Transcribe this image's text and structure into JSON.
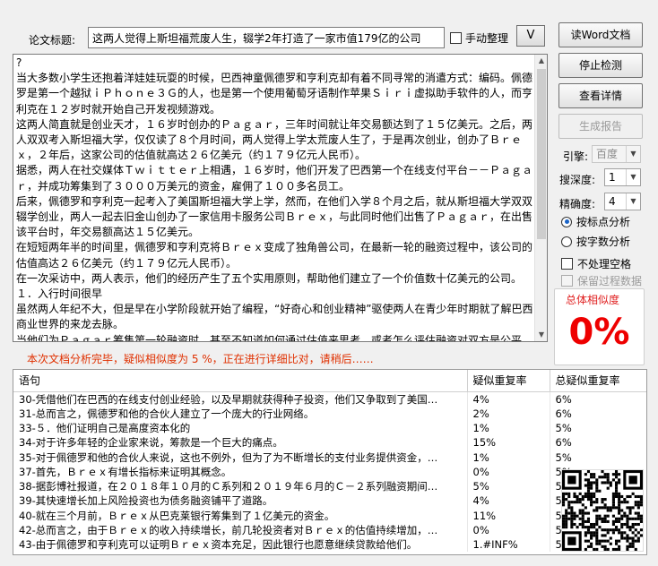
{
  "title_field": {
    "label": "论文标题:",
    "value": "这两人觉得上斯坦福荒废人生，辍学2年打造了一家市值179亿的公司"
  },
  "manual_check": {
    "label": "手动整理",
    "checked": false
  },
  "v_button": {
    "label": "V"
  },
  "document_text": "?\n当大多数小学生还抱着洋娃娃玩耍的时候，巴西神童佩德罗和亨利克却有着不同寻常的消遣方式：编码。佩德罗是第一个越狱ｉＰｈｏｎｅ３Ｇ的人，也是第一个使用葡萄牙语制作苹果Ｓｉｒｉ虚拟助手软件的人，而亨利克在１２岁时就开始自己开发视频游戏。\n这两人简直就是创业天才，１６岁时创办的Ｐａｇａｒ，三年时间就让年交易额达到了１５亿美元。之后，两人双双考入斯坦福大学，仅仅读了８个月时间，两人觉得上学太荒废人生了，于是再次创业，创办了Ｂｒｅｘ，２年后，这家公司的估值就高达２６亿美元（约１７９亿元人民币）。\n据悉，两人在社交媒体Ｔｗｉｔｔｅｒ上相遇，１６岁时，他们开发了巴西第一个在线支付平台－－Ｐａｇａｒ，并成功筹集到了３０００万美元的资金，雇佣了１００多名员工。\n后来，佩德罗和亨利克一起考入了美国斯坦福大学上学，然而，在他们入学８个月之后，就从斯坦福大学双双辍学创业，两人一起去旧金山创办了一家信用卡服务公司Ｂｒｅｘ，与此同时他们出售了Ｐａｇａｒ，在出售该平台时，年交易额高达１５亿美元。\n在短短两年半的时间里，佩德罗和亨利克将Ｂｒｅｘ变成了独角兽公司，在最新一轮的融资过程中，该公司的估值高达２６亿美元（约１７９亿元人民币）。\n在一次采访中，两人表示，他们的经历产生了五个实用原则，帮助他们建立了一个价值数十亿美元的公司。\n１．入行时间很早\n虽然两人年纪不大，但是早在小学阶段就开始了编程，“好奇心和创业精神”驱使两人在青少年时期就了解巴西商业世界的来龙去脉。\n当他们为Ｐａｇａｒ筹集第一轮融资时，甚至不知道如何通过估值来思考，或者怎么评估融资对双方是公平的，但那没关系，这种经历为他们的下一次创业积累了经验。",
  "status_message": "本次文档分析完毕，疑似相似度为 5 %，正在进行详细比对，请稍后……",
  "table": {
    "headers": [
      "语句",
      "疑似重复率",
      "总疑似重复率"
    ],
    "rows": [
      [
        "30-凭借他们在巴西的在线支付创业经验，以及早期就获得种子投资，他们又争取到了美国…",
        "4%",
        "6%"
      ],
      [
        "31-总而言之，佩德罗和他的合伙人建立了一个庞大的行业网络。",
        "2%",
        "6%"
      ],
      [
        "33-５．他们证明自己是高度资本化的",
        "1%",
        "5%"
      ],
      [
        "34-对于许多年轻的企业家来说，筹款是一个巨大的痛点。",
        "15%",
        "6%"
      ],
      [
        "35-对于佩德罗和他的合伙人来说，这也不例外，但为了为不断增长的支付业务提供资金，…",
        "1%",
        "5%"
      ],
      [
        "37-首先，Ｂｒｅｘ有增长指标来证明其概念。",
        "0%",
        "5%"
      ],
      [
        "38-据彭博社报道，在２０１８年１０月的Ｃ系列和２０１９年６月的Ｃ－２系列融资期间…",
        "5%",
        "5%"
      ],
      [
        "39-其快速增长加上风险投资也为债务融资铺平了道路。",
        "4%",
        "5%"
      ],
      [
        "40-就在三个月前，Ｂｒｅｘ从巴克莱银行筹集到了１亿美元的资金。",
        "11%",
        "5%"
      ],
      [
        "42-总而言之，由于Ｂｒｅｘ的收入持续增长，前几轮投资者对Ｂｒｅｘ的估值持续增加，…",
        "0%",
        "5%"
      ],
      [
        "43-由于佩德罗和亨利克可以证明Ｂｒｅｘ资本充足，因此银行也愿意继续贷款给他们。",
        "1.#INF%",
        "5%"
      ]
    ]
  },
  "buttons": {
    "read_word": "读Word文档",
    "stop_detect": "停止检测",
    "view_details": "查看详情",
    "gen_report": "生成报告"
  },
  "engine": {
    "label": "引擎:",
    "value": "百度"
  },
  "search_depth": {
    "label": "搜深度:",
    "value": "1"
  },
  "precision": {
    "label": "精确度:",
    "value": "4"
  },
  "analysis_mode": {
    "by_punct": "按标点分析",
    "by_chars": "按字数分析",
    "selected": "by_punct"
  },
  "options": {
    "no_space": "不处理空格",
    "keep_data": "保留过程数据"
  },
  "similarity": {
    "title": "总体相似度",
    "value": "0%"
  },
  "colors": {
    "accent_red": "#ee0000",
    "status_orange": "#e03000"
  }
}
